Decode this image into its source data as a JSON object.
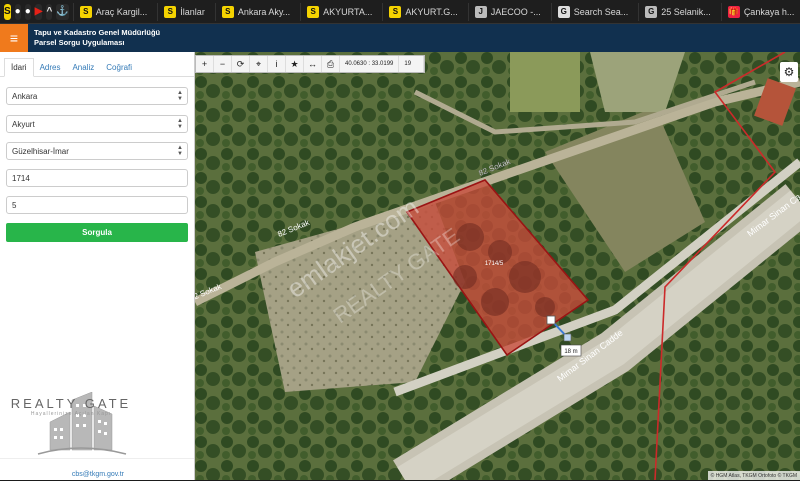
{
  "browser": {
    "bookmark_icons": [
      {
        "icon": "sahibinden-icon",
        "glyph": "S",
        "color": "#f5d300"
      },
      {
        "icon": "pin-icon",
        "glyph": "●",
        "color": "#fff"
      },
      {
        "icon": "location-icon",
        "glyph": "●",
        "color": "#fff"
      },
      {
        "icon": "youtube-icon",
        "glyph": "▶",
        "color": "#e62117"
      },
      {
        "icon": "app-icon",
        "glyph": "^",
        "color": "#e8e8e8"
      },
      {
        "icon": "anchor-icon",
        "glyph": "⚓",
        "color": "#e8e8e8"
      }
    ],
    "tabs": [
      {
        "label": "Araç Kargil...",
        "icon": "sahibinden-icon",
        "glyph": "S",
        "color": "#f5d300"
      },
      {
        "label": "İlanlar",
        "icon": "sahibinden-icon",
        "glyph": "S",
        "color": "#f5d300"
      },
      {
        "label": "Ankara Aky...",
        "icon": "sahibinden-icon",
        "glyph": "S",
        "color": "#f5d300"
      },
      {
        "label": "AKYURTA...",
        "icon": "sahibinden-icon",
        "glyph": "S",
        "color": "#f5d300"
      },
      {
        "label": "AKYURT.G...",
        "icon": "sahibinden-icon",
        "glyph": "S",
        "color": "#f5d300"
      },
      {
        "label": "JAECOO -...",
        "icon": "jaecoo-icon",
        "glyph": "J",
        "color": "#bbb"
      },
      {
        "label": "Search Sea...",
        "icon": "google-icon",
        "glyph": "G",
        "color": "#ddd"
      },
      {
        "label": "25 Selanik...",
        "icon": "document-icon",
        "glyph": "G",
        "color": "#bbb"
      },
      {
        "label": "Çankaya h...",
        "icon": "gift-icon",
        "glyph": "🎁",
        "color": "#e24"
      }
    ]
  },
  "header": {
    "title_line1": "Tapu ve Kadastro Genel Müdürlüğü",
    "title_line2": "Parsel Sorgu Uygulaması",
    "menu_glyph": "≡"
  },
  "panel": {
    "tabs": [
      "İdari",
      "Adres",
      "Analiz",
      "Coğrafi"
    ],
    "active_tab": "İdari",
    "province": "Ankara",
    "district": "Akyurt",
    "neighborhood": "Güzelhisar-İmar",
    "block": "1714",
    "parcel": "5",
    "submit_label": "Sorgula",
    "brand_name": "REALTY GATE",
    "brand_slogan": "Hayallerinize Açılan Kapı",
    "email": "cbs@tkgm.gov.tr"
  },
  "map": {
    "toolbar": {
      "tools": [
        {
          "icon": "zoom-in-icon",
          "glyph": "+"
        },
        {
          "icon": "zoom-out-icon",
          "glyph": "−"
        },
        {
          "icon": "refresh-icon",
          "glyph": "⟳"
        },
        {
          "icon": "locate-icon",
          "glyph": "⌖"
        },
        {
          "icon": "info-icon",
          "glyph": "i"
        },
        {
          "icon": "star-icon",
          "glyph": "★"
        },
        {
          "icon": "measure-icon",
          "glyph": "↔"
        },
        {
          "icon": "print-icon",
          "glyph": "⎙"
        }
      ],
      "coordinates": "40.0630 : 33.0199",
      "zoom_level": "19"
    },
    "settings_glyph": "⚙",
    "labels": {
      "street_82_top": "82 Sokak",
      "street_82_left": "82 Sokak",
      "street_82_edge": "82 Sokak",
      "street_mimar_bottom": "Mimar Sinan Cadde",
      "street_mimar_right": "Mimar Sinan Ca",
      "parcel_label": "1714/5",
      "measurement": "18 m",
      "watermark_1": "emlakjet.com",
      "watermark_2": "REALTY GATE"
    },
    "attribution": "© HGM Atlas, TKGM Ortofoto © TKGM",
    "colors": {
      "parcel_fill": "#c84a3a",
      "parcel_stroke": "#9a1414",
      "boundary": "#cc2a2a"
    }
  }
}
